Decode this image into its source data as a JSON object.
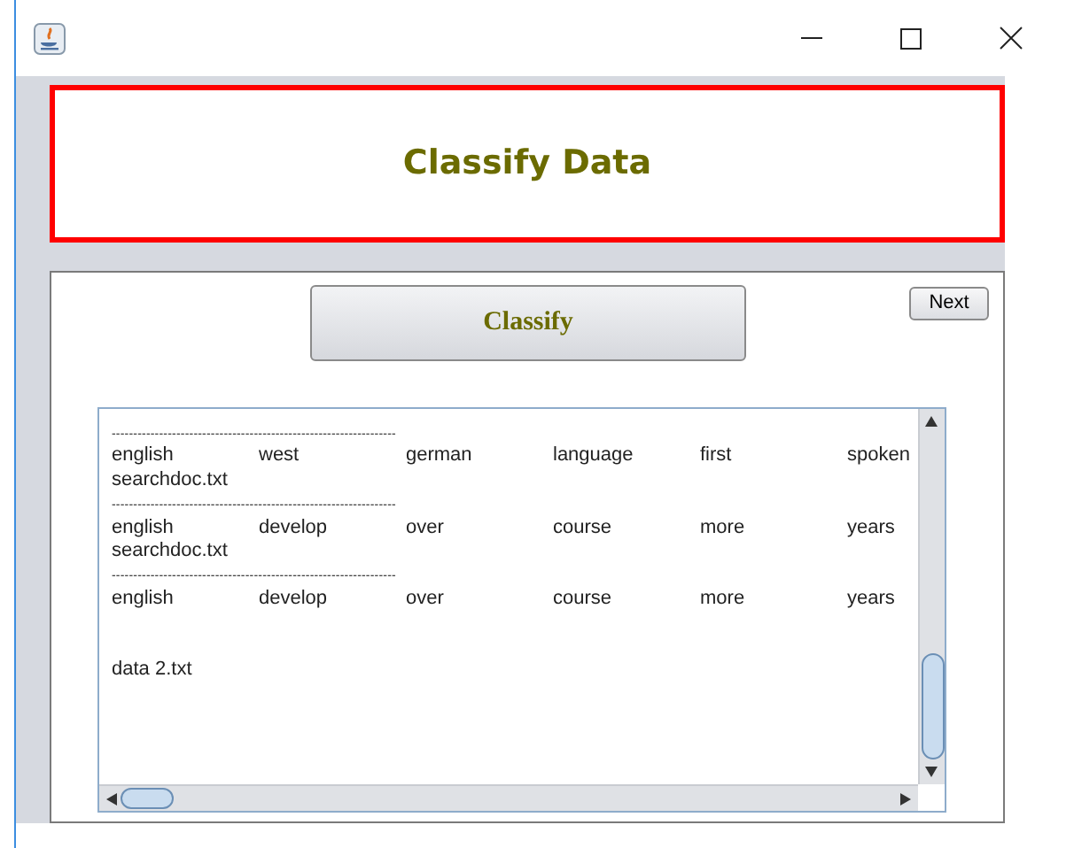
{
  "banner": {
    "title": "Classify Data"
  },
  "classify_button": "Classify",
  "next_button": "Next",
  "output_lines": [
    {
      "kind": "rule",
      "text": "------------------------------------------------------------------"
    },
    {
      "kind": "words",
      "words": [
        "english",
        "west",
        "german",
        "language",
        "first",
        "spoken"
      ]
    },
    {
      "kind": "text",
      "text": "searchdoc.txt"
    },
    {
      "kind": "rule",
      "text": "------------------------------------------------------------------"
    },
    {
      "kind": "words",
      "words": [
        "english",
        "develop",
        "over",
        "course",
        "more",
        "years"
      ]
    },
    {
      "kind": "text",
      "text": "searchdoc.txt"
    },
    {
      "kind": "rule",
      "text": "------------------------------------------------------------------"
    },
    {
      "kind": "words",
      "words": [
        "english",
        "develop",
        "over",
        "course",
        "more",
        "years"
      ]
    },
    {
      "kind": "blank"
    },
    {
      "kind": "blank"
    },
    {
      "kind": "text",
      "text": "data 2.txt"
    }
  ]
}
